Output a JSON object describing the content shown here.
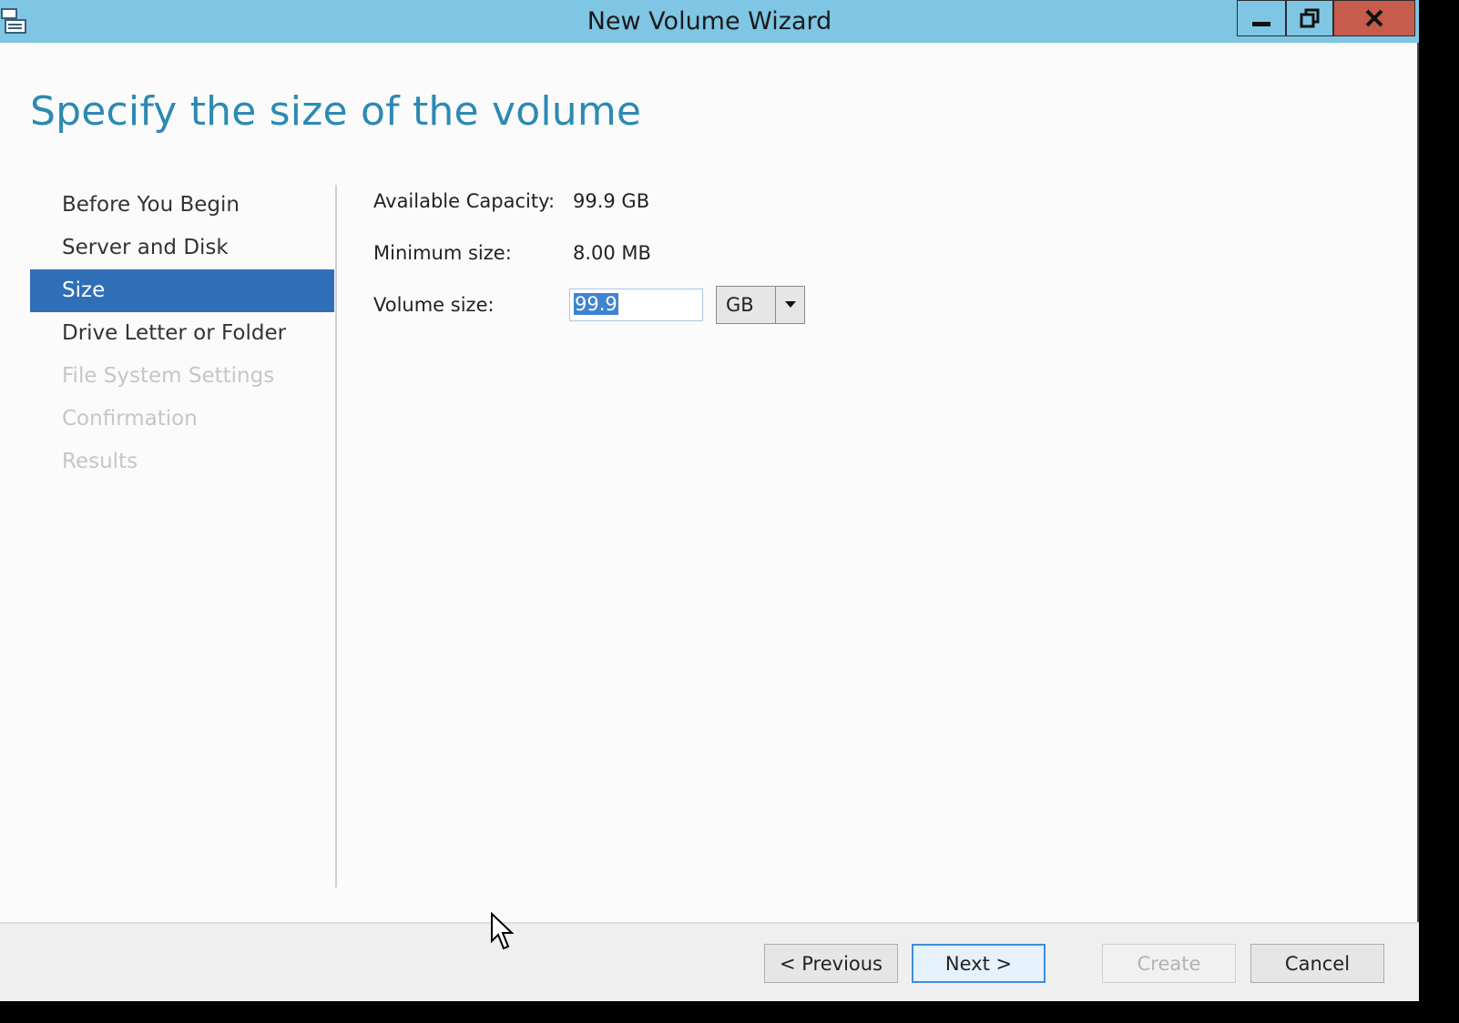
{
  "window": {
    "title": "New Volume Wizard"
  },
  "page": {
    "heading": "Specify the size of the volume"
  },
  "nav": {
    "items": [
      {
        "label": "Before You Begin",
        "state": "normal"
      },
      {
        "label": "Server and Disk",
        "state": "normal"
      },
      {
        "label": "Size",
        "state": "active"
      },
      {
        "label": "Drive Letter or Folder",
        "state": "normal"
      },
      {
        "label": "File System Settings",
        "state": "disabled"
      },
      {
        "label": "Confirmation",
        "state": "disabled"
      },
      {
        "label": "Results",
        "state": "disabled"
      }
    ]
  },
  "form": {
    "available_label": "Available Capacity:",
    "available_value": "99.9 GB",
    "minimum_label": "Minimum size:",
    "minimum_value": "8.00 MB",
    "volume_label": "Volume size:",
    "volume_value": "99.9",
    "unit_selected": "GB"
  },
  "footer": {
    "previous": "< Previous",
    "next": "Next >",
    "create": "Create",
    "cancel": "Cancel"
  },
  "colors": {
    "titlebar": "#7ec6e4",
    "close": "#c75b4c",
    "accent": "#2f6fb8",
    "heading": "#2c8ab3"
  }
}
